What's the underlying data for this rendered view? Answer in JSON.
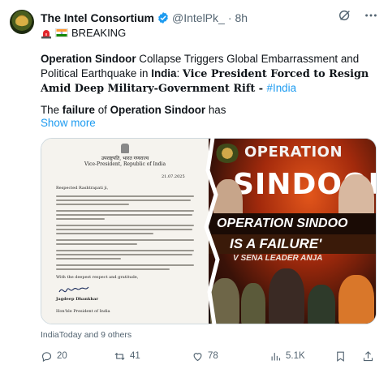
{
  "account": {
    "display_name": "The Intel Consortium",
    "handle": "@IntelPk_",
    "separator": "·",
    "time": "8h"
  },
  "breaking_label": "BREAKING",
  "post": {
    "p1_bold1": "Operation Sindoor",
    "p1_text1": " Collapse Triggers Global Embarrassment and Political Earthquake in ",
    "p1_bold2": "India",
    "p1_text2": ": ",
    "p1_serif1": "Vice President",
    "p1_serif2": " Forced to Resign Amid Deep Military-Government Rift - ",
    "p1_hashtag": "#India",
    "p2_text1": "The ",
    "p2_bold1": "failure",
    "p2_text2": " of ",
    "p2_bold2": "Operation Sindoor",
    "p2_text3": " has",
    "show_more": "Show more"
  },
  "media": {
    "letter": {
      "header_hindi": "उपराष्ट्रपति, भारत गणराज्य",
      "header_en": "Vice-President, Republic of India",
      "date": "21.07.2025",
      "salutation": "Respected Rashtrapati ji,",
      "closing": "With the deepest respect and gratitude,",
      "signatory": "Jagdeep Dhankhar",
      "footer": "Hon'ble President of India"
    },
    "poster": {
      "title_top": "OPERATION",
      "title_mid": "SINDOOR",
      "banner1": "OPERATION SINDOO",
      "banner2": "IS A FAILURE'",
      "banner3": "V SENA LEADER ANJA"
    }
  },
  "attribution": "IndiaToday and 9 others",
  "actions": {
    "replies": "20",
    "reposts": "41",
    "likes": "78",
    "views": "5.1K"
  },
  "colors": {
    "link": "#1d9bf0",
    "muted": "#536471",
    "verified": "#1d9bf0"
  }
}
